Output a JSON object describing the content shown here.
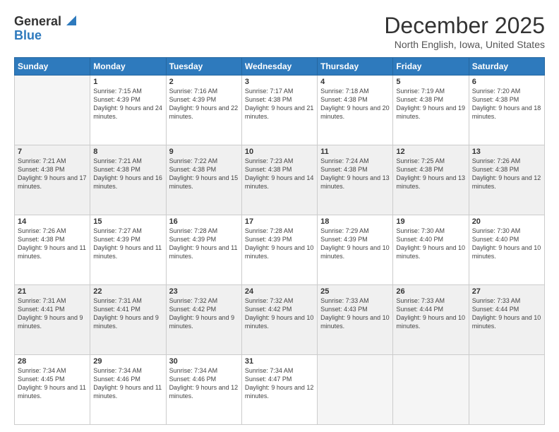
{
  "header": {
    "logo_general": "General",
    "logo_blue": "Blue",
    "title": "December 2025",
    "location": "North English, Iowa, United States"
  },
  "weekdays": [
    "Sunday",
    "Monday",
    "Tuesday",
    "Wednesday",
    "Thursday",
    "Friday",
    "Saturday"
  ],
  "weeks": [
    [
      {
        "day": "",
        "empty": true
      },
      {
        "day": "1",
        "sunrise": "Sunrise: 7:15 AM",
        "sunset": "Sunset: 4:39 PM",
        "daylight": "Daylight: 9 hours and 24 minutes."
      },
      {
        "day": "2",
        "sunrise": "Sunrise: 7:16 AM",
        "sunset": "Sunset: 4:39 PM",
        "daylight": "Daylight: 9 hours and 22 minutes."
      },
      {
        "day": "3",
        "sunrise": "Sunrise: 7:17 AM",
        "sunset": "Sunset: 4:38 PM",
        "daylight": "Daylight: 9 hours and 21 minutes."
      },
      {
        "day": "4",
        "sunrise": "Sunrise: 7:18 AM",
        "sunset": "Sunset: 4:38 PM",
        "daylight": "Daylight: 9 hours and 20 minutes."
      },
      {
        "day": "5",
        "sunrise": "Sunrise: 7:19 AM",
        "sunset": "Sunset: 4:38 PM",
        "daylight": "Daylight: 9 hours and 19 minutes."
      },
      {
        "day": "6",
        "sunrise": "Sunrise: 7:20 AM",
        "sunset": "Sunset: 4:38 PM",
        "daylight": "Daylight: 9 hours and 18 minutes."
      }
    ],
    [
      {
        "day": "7",
        "sunrise": "Sunrise: 7:21 AM",
        "sunset": "Sunset: 4:38 PM",
        "daylight": "Daylight: 9 hours and 17 minutes."
      },
      {
        "day": "8",
        "sunrise": "Sunrise: 7:21 AM",
        "sunset": "Sunset: 4:38 PM",
        "daylight": "Daylight: 9 hours and 16 minutes."
      },
      {
        "day": "9",
        "sunrise": "Sunrise: 7:22 AM",
        "sunset": "Sunset: 4:38 PM",
        "daylight": "Daylight: 9 hours and 15 minutes."
      },
      {
        "day": "10",
        "sunrise": "Sunrise: 7:23 AM",
        "sunset": "Sunset: 4:38 PM",
        "daylight": "Daylight: 9 hours and 14 minutes."
      },
      {
        "day": "11",
        "sunrise": "Sunrise: 7:24 AM",
        "sunset": "Sunset: 4:38 PM",
        "daylight": "Daylight: 9 hours and 13 minutes."
      },
      {
        "day": "12",
        "sunrise": "Sunrise: 7:25 AM",
        "sunset": "Sunset: 4:38 PM",
        "daylight": "Daylight: 9 hours and 13 minutes."
      },
      {
        "day": "13",
        "sunrise": "Sunrise: 7:26 AM",
        "sunset": "Sunset: 4:38 PM",
        "daylight": "Daylight: 9 hours and 12 minutes."
      }
    ],
    [
      {
        "day": "14",
        "sunrise": "Sunrise: 7:26 AM",
        "sunset": "Sunset: 4:38 PM",
        "daylight": "Daylight: 9 hours and 11 minutes."
      },
      {
        "day": "15",
        "sunrise": "Sunrise: 7:27 AM",
        "sunset": "Sunset: 4:39 PM",
        "daylight": "Daylight: 9 hours and 11 minutes."
      },
      {
        "day": "16",
        "sunrise": "Sunrise: 7:28 AM",
        "sunset": "Sunset: 4:39 PM",
        "daylight": "Daylight: 9 hours and 11 minutes."
      },
      {
        "day": "17",
        "sunrise": "Sunrise: 7:28 AM",
        "sunset": "Sunset: 4:39 PM",
        "daylight": "Daylight: 9 hours and 10 minutes."
      },
      {
        "day": "18",
        "sunrise": "Sunrise: 7:29 AM",
        "sunset": "Sunset: 4:39 PM",
        "daylight": "Daylight: 9 hours and 10 minutes."
      },
      {
        "day": "19",
        "sunrise": "Sunrise: 7:30 AM",
        "sunset": "Sunset: 4:40 PM",
        "daylight": "Daylight: 9 hours and 10 minutes."
      },
      {
        "day": "20",
        "sunrise": "Sunrise: 7:30 AM",
        "sunset": "Sunset: 4:40 PM",
        "daylight": "Daylight: 9 hours and 10 minutes."
      }
    ],
    [
      {
        "day": "21",
        "sunrise": "Sunrise: 7:31 AM",
        "sunset": "Sunset: 4:41 PM",
        "daylight": "Daylight: 9 hours and 9 minutes."
      },
      {
        "day": "22",
        "sunrise": "Sunrise: 7:31 AM",
        "sunset": "Sunset: 4:41 PM",
        "daylight": "Daylight: 9 hours and 9 minutes."
      },
      {
        "day": "23",
        "sunrise": "Sunrise: 7:32 AM",
        "sunset": "Sunset: 4:42 PM",
        "daylight": "Daylight: 9 hours and 9 minutes."
      },
      {
        "day": "24",
        "sunrise": "Sunrise: 7:32 AM",
        "sunset": "Sunset: 4:42 PM",
        "daylight": "Daylight: 9 hours and 10 minutes."
      },
      {
        "day": "25",
        "sunrise": "Sunrise: 7:33 AM",
        "sunset": "Sunset: 4:43 PM",
        "daylight": "Daylight: 9 hours and 10 minutes."
      },
      {
        "day": "26",
        "sunrise": "Sunrise: 7:33 AM",
        "sunset": "Sunset: 4:44 PM",
        "daylight": "Daylight: 9 hours and 10 minutes."
      },
      {
        "day": "27",
        "sunrise": "Sunrise: 7:33 AM",
        "sunset": "Sunset: 4:44 PM",
        "daylight": "Daylight: 9 hours and 10 minutes."
      }
    ],
    [
      {
        "day": "28",
        "sunrise": "Sunrise: 7:34 AM",
        "sunset": "Sunset: 4:45 PM",
        "daylight": "Daylight: 9 hours and 11 minutes."
      },
      {
        "day": "29",
        "sunrise": "Sunrise: 7:34 AM",
        "sunset": "Sunset: 4:46 PM",
        "daylight": "Daylight: 9 hours and 11 minutes."
      },
      {
        "day": "30",
        "sunrise": "Sunrise: 7:34 AM",
        "sunset": "Sunset: 4:46 PM",
        "daylight": "Daylight: 9 hours and 12 minutes."
      },
      {
        "day": "31",
        "sunrise": "Sunrise: 7:34 AM",
        "sunset": "Sunset: 4:47 PM",
        "daylight": "Daylight: 9 hours and 12 minutes."
      },
      {
        "day": "",
        "empty": true
      },
      {
        "day": "",
        "empty": true
      },
      {
        "day": "",
        "empty": true
      }
    ]
  ]
}
